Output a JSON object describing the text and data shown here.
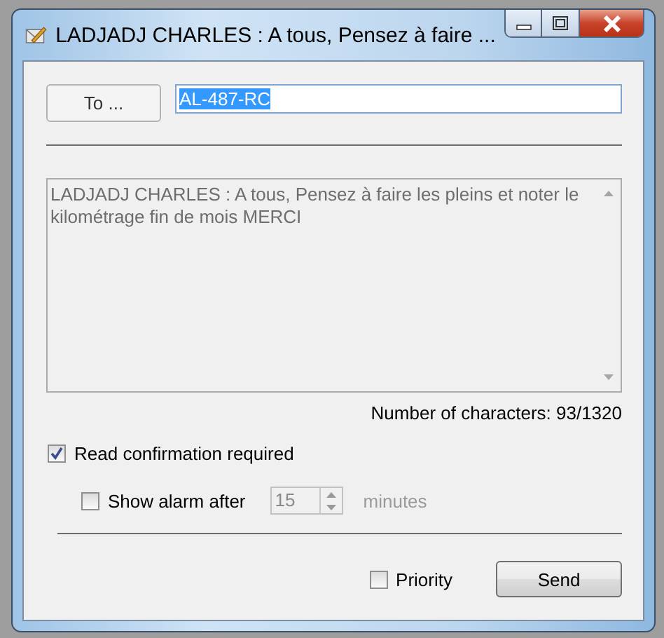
{
  "window": {
    "title": "LADJADJ CHARLES : A tous, Pensez à faire ..."
  },
  "recipient": {
    "button": "To ...",
    "value": "AL-487-RC",
    "selected": true
  },
  "message": {
    "text": "LADJADJ CHARLES : A tous, Pensez à faire les pleins et noter le kilométrage fin de mois MERCI",
    "disabled": true
  },
  "counter": "Number of characters: 93/1320",
  "read_confirmation": {
    "label": "Read confirmation required",
    "checked": true
  },
  "alarm": {
    "label": "Show alarm after",
    "checked": false,
    "value": "15",
    "unit": "minutes",
    "disabled": true
  },
  "priority": {
    "label": "Priority",
    "checked": false
  },
  "buttons": [
    {
      "label": "Send"
    }
  ]
}
